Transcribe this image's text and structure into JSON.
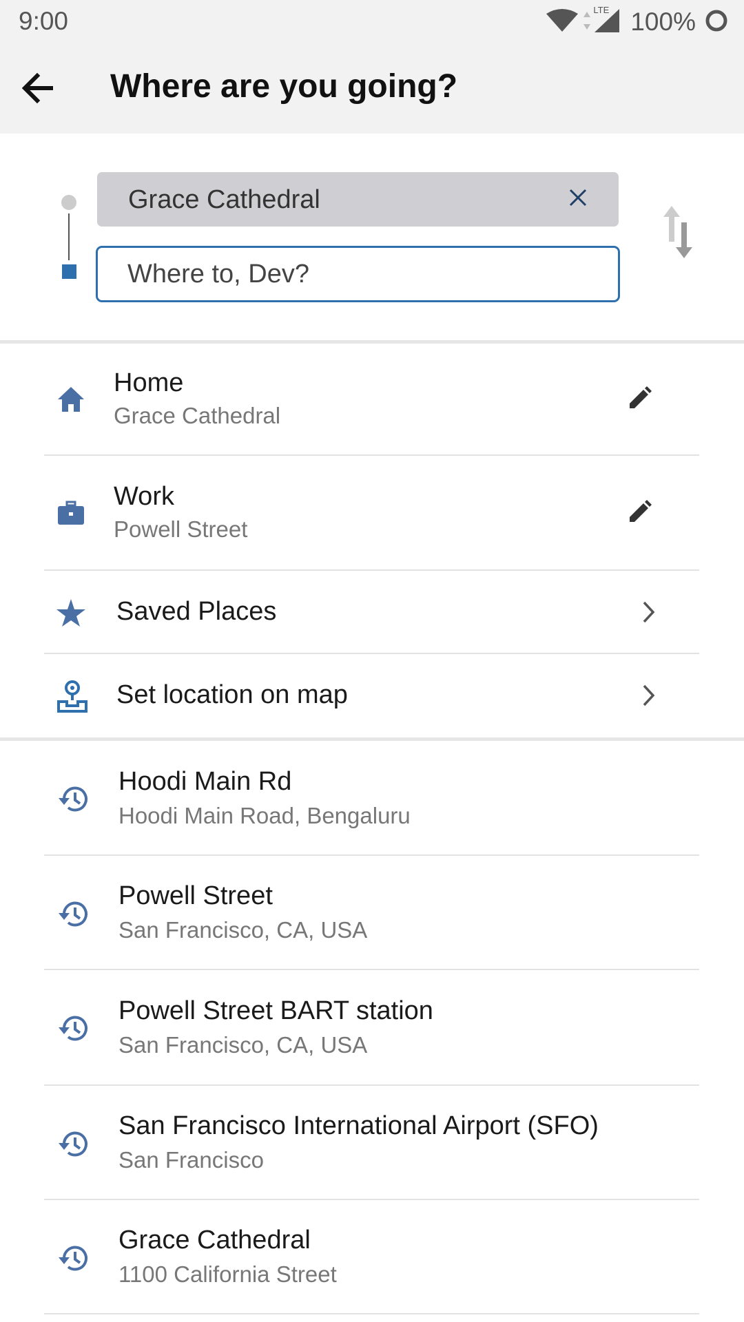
{
  "status_bar": {
    "time": "9:00",
    "battery": "100%",
    "network": "LTE"
  },
  "header": {
    "title": "Where are you going?"
  },
  "route": {
    "pickup": "Grace Cathedral",
    "destination_value": "",
    "destination_placeholder": "Where to, Dev?"
  },
  "shortcuts": [
    {
      "icon": "home-icon",
      "title": "Home",
      "subtitle": "Grace Cathedral",
      "action": "edit-icon"
    },
    {
      "icon": "briefcase-icon",
      "title": "Work",
      "subtitle": "Powell Street",
      "action": "edit-icon"
    },
    {
      "icon": "star-icon",
      "title": "Saved Places",
      "action": "chevron-right-icon"
    },
    {
      "icon": "map-pin-person-icon",
      "title": "Set location on map",
      "action": "chevron-right-icon"
    }
  ],
  "recents": [
    {
      "icon": "history-icon",
      "title": "Hoodi Main Rd",
      "subtitle": "Hoodi Main Road, Bengaluru"
    },
    {
      "icon": "history-icon",
      "title": "Powell Street",
      "subtitle": "San Francisco, CA, USA"
    },
    {
      "icon": "history-icon",
      "title": "Powell Street BART station",
      "subtitle": "San Francisco, CA, USA"
    },
    {
      "icon": "history-icon",
      "title": "San Francisco International Airport (SFO)",
      "subtitle": "San Francisco"
    },
    {
      "icon": "history-icon",
      "title": "Grace Cathedral",
      "subtitle": "1100 California Street"
    }
  ],
  "colors": {
    "accent": "#2e6fad",
    "icon_blue": "#4a6fa5",
    "bar_bg": "#f2f2f2"
  }
}
